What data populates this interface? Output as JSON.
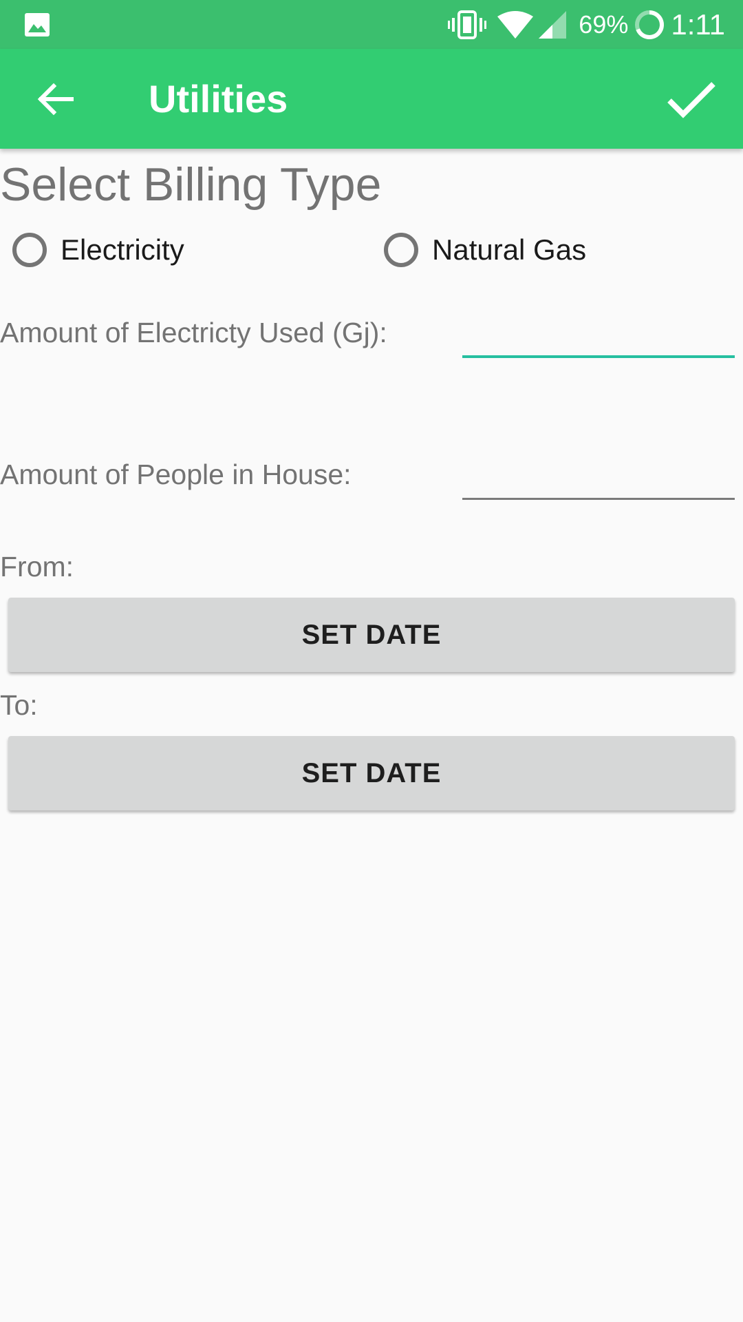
{
  "status_bar": {
    "left_icon": "image-icon",
    "icons": [
      "vibrate-icon",
      "wifi-icon",
      "cell-signal-icon"
    ],
    "battery_percent": "69%",
    "battery_icon": "battery-circle-icon",
    "time": "1:11",
    "background_color": "#3bbf6e"
  },
  "app_bar": {
    "title": "Utilities",
    "back_icon": "arrow-back-icon",
    "confirm_icon": "checkmark-icon",
    "background_color": "#32cd72"
  },
  "billing": {
    "heading": "Select Billing Type",
    "options": [
      {
        "label": "Electricity",
        "selected": false
      },
      {
        "label": "Natural Gas",
        "selected": false
      }
    ]
  },
  "fields": {
    "electricity_label": "Amount of Electricty Used (Gj):",
    "electricity_value": "",
    "people_label": "Amount of People in House:",
    "people_value": ""
  },
  "dates": {
    "from_label": "From:",
    "from_button": "SET DATE",
    "to_label": "To:",
    "to_button": "SET DATE"
  },
  "colors": {
    "accent": "#26bfa0",
    "label_text": "#737373"
  }
}
